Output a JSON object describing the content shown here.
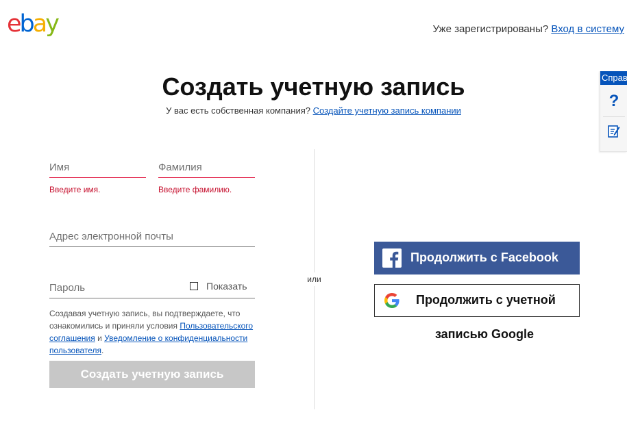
{
  "header": {
    "logo_letters": [
      "e",
      "b",
      "a",
      "y"
    ],
    "logo_colors": [
      "#e53238",
      "#0064d2",
      "#f5af02",
      "#86b817"
    ],
    "signin_prompt": "Уже зарегистрированы?",
    "signin_link": "Вход в систему"
  },
  "page": {
    "title": "Создать учетную запись",
    "business_prompt": "У вас есть собственная компания?",
    "business_link": "Создайте учетную запись компании"
  },
  "help_panel": {
    "tab_label": "Справка",
    "help_icon": "question-icon",
    "feedback_icon": "feedback-icon"
  },
  "form": {
    "first_name": {
      "placeholder": "Имя",
      "value": "",
      "error": "Введите имя."
    },
    "last_name": {
      "placeholder": "Фамилия",
      "value": "",
      "error": "Введите фамилию."
    },
    "email": {
      "placeholder": "Адрес электронной почты",
      "value": ""
    },
    "password": {
      "placeholder": "Пароль",
      "value": ""
    },
    "show_password_label": "Показать",
    "terms_text_1": "Создавая учетную запись, вы подтверждаете, что ознакомились и приняли условия",
    "terms_link_1": "Пользовательского соглашения",
    "terms_and": "и",
    "terms_link_2": "Уведомление о конфиденциальности пользователя",
    "create_button": "Создать учетную запись"
  },
  "divider_label": "или",
  "social": {
    "facebook_button": "Продолжить с Facebook",
    "google_button_line1": "Продолжить с учетной",
    "google_button_line2": "записью Google",
    "colors": {
      "facebook": "#3b5998",
      "accent_link": "#0654ba",
      "error": "#c6102e"
    }
  }
}
